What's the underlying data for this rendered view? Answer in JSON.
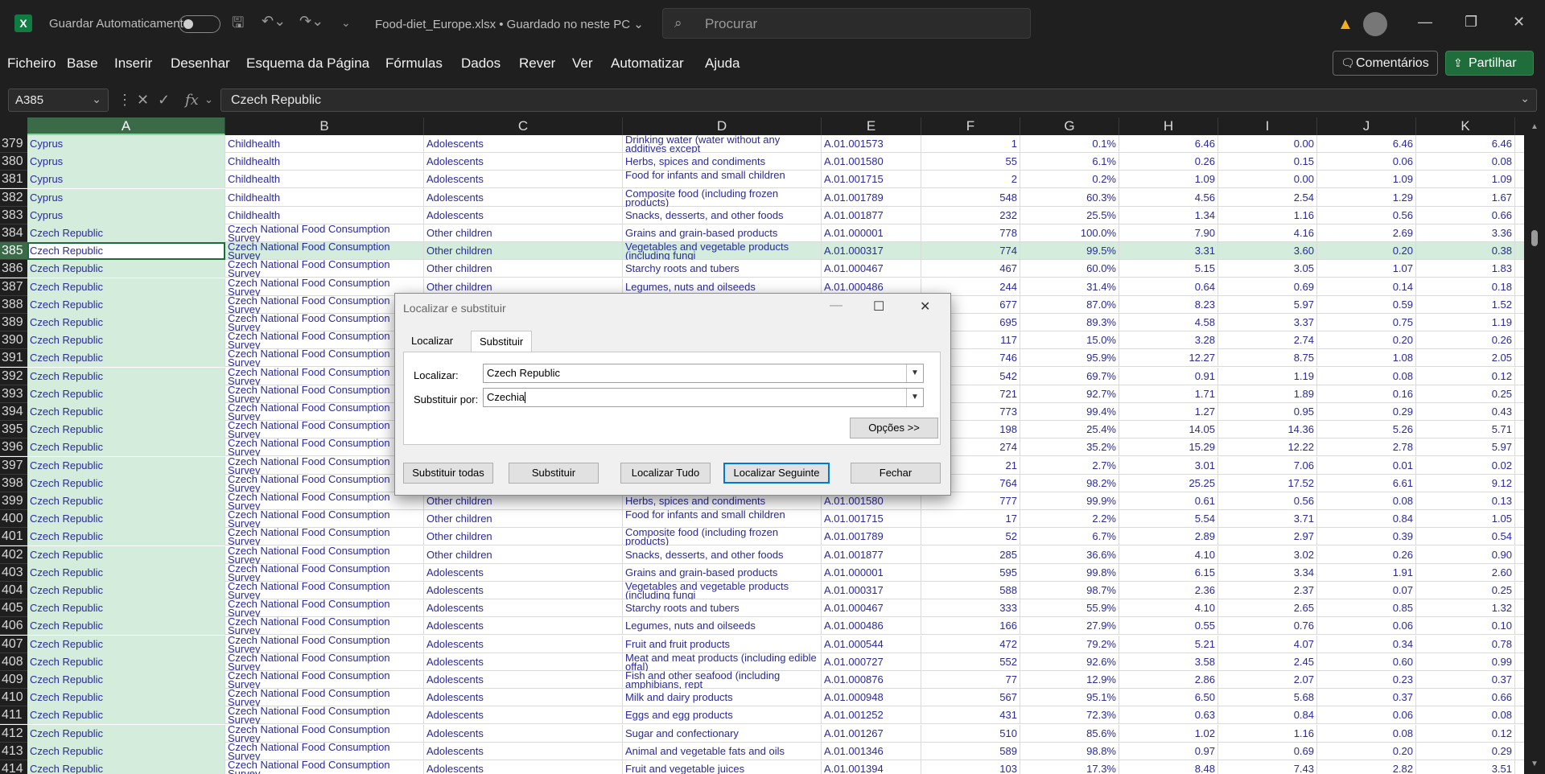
{
  "titlebar": {
    "app_icon": "X",
    "autosave_label": "Guardar Automaticamente",
    "document_title": "Food-diet_Europe.xlsx • Guardado no neste PC ⌄",
    "search_placeholder": "Procurar"
  },
  "menu": [
    "Ficheiro",
    "Base",
    "Inserir",
    "Desenhar",
    "Esquema da Página",
    "Fórmulas",
    "Dados",
    "Rever",
    "Ver",
    "Automatizar",
    "Ajuda"
  ],
  "actions": {
    "comments": "Comentários",
    "share": "Partilhar"
  },
  "formula_bar": {
    "name_box": "A385",
    "formula": "Czech Republic"
  },
  "columns": [
    "A",
    "B",
    "C",
    "D",
    "E",
    "F",
    "G",
    "H",
    "I",
    "J",
    "K"
  ],
  "selected_column": "A",
  "active_row": "385",
  "rows": [
    [
      "379",
      "Cyprus",
      "Childhealth",
      "Adolescents",
      "Drinking water (water without any additives except",
      "A.01.001573",
      "1",
      "0.1%",
      "6.46",
      "0.00",
      "6.46",
      "6.46"
    ],
    [
      "380",
      "Cyprus",
      "Childhealth",
      "Adolescents",
      "Herbs, spices and condiments",
      "A.01.001580",
      "55",
      "6.1%",
      "0.26",
      "0.15",
      "0.06",
      "0.08"
    ],
    [
      "381",
      "Cyprus",
      "Childhealth",
      "Adolescents",
      "Food for infants and small children",
      "A.01.001715",
      "2",
      "0.2%",
      "1.09",
      "0.00",
      "1.09",
      "1.09"
    ],
    [
      "382",
      "Cyprus",
      "Childhealth",
      "Adolescents",
      "Composite food (including frozen products)",
      "A.01.001789",
      "548",
      "60.3%",
      "4.56",
      "2.54",
      "1.29",
      "1.67"
    ],
    [
      "383",
      "Cyprus",
      "Childhealth",
      "Adolescents",
      "Snacks, desserts, and other foods",
      "A.01.001877",
      "232",
      "25.5%",
      "1.34",
      "1.16",
      "0.56",
      "0.66"
    ],
    [
      "384",
      "Czech Republic",
      "Czech National Food Consumption Survey",
      "Other children",
      "Grains and grain-based products",
      "A.01.000001",
      "778",
      "100.0%",
      "7.90",
      "4.16",
      "2.69",
      "3.36"
    ],
    [
      "385",
      "Czech Republic",
      "Czech National Food Consumption Survey",
      "Other children",
      "Vegetables and vegetable products (including fungi",
      "A.01.000317",
      "774",
      "99.5%",
      "3.31",
      "3.60",
      "0.20",
      "0.38"
    ],
    [
      "386",
      "Czech Republic",
      "Czech National Food Consumption Survey",
      "Other children",
      "Starchy roots and tubers",
      "A.01.000467",
      "467",
      "60.0%",
      "5.15",
      "3.05",
      "1.07",
      "1.83"
    ],
    [
      "387",
      "Czech Republic",
      "Czech National Food Consumption Survey",
      "Other children",
      "Legumes, nuts and oilseeds",
      "A.01.000486",
      "244",
      "31.4%",
      "0.64",
      "0.69",
      "0.14",
      "0.18"
    ],
    [
      "388",
      "Czech Republic",
      "Czech National Food Consumption Survey",
      "",
      "",
      "",
      "677",
      "87.0%",
      "8.23",
      "5.97",
      "0.59",
      "1.52"
    ],
    [
      "389",
      "Czech Republic",
      "Czech National Food Consumption Survey",
      "",
      "",
      "",
      "695",
      "89.3%",
      "4.58",
      "3.37",
      "0.75",
      "1.19"
    ],
    [
      "390",
      "Czech Republic",
      "Czech National Food Consumption Survey",
      "",
      "",
      "",
      "117",
      "15.0%",
      "3.28",
      "2.74",
      "0.20",
      "0.26"
    ],
    [
      "391",
      "Czech Republic",
      "Czech National Food Consumption Survey",
      "",
      "",
      "",
      "746",
      "95.9%",
      "12.27",
      "8.75",
      "1.08",
      "2.05"
    ],
    [
      "392",
      "Czech Republic",
      "Czech National Food Consumption Survey",
      "",
      "",
      "",
      "542",
      "69.7%",
      "0.91",
      "1.19",
      "0.08",
      "0.12"
    ],
    [
      "393",
      "Czech Republic",
      "Czech National Food Consumption Survey",
      "",
      "",
      "",
      "721",
      "92.7%",
      "1.71",
      "1.89",
      "0.16",
      "0.25"
    ],
    [
      "394",
      "Czech Republic",
      "Czech National Food Consumption Survey",
      "",
      "",
      "",
      "773",
      "99.4%",
      "1.27",
      "0.95",
      "0.29",
      "0.43"
    ],
    [
      "395",
      "Czech Republic",
      "Czech National Food Consumption Survey",
      "",
      "",
      "",
      "198",
      "25.4%",
      "14.05",
      "14.36",
      "5.26",
      "5.71"
    ],
    [
      "396",
      "Czech Republic",
      "Czech National Food Consumption Survey",
      "",
      "",
      "",
      "274",
      "35.2%",
      "15.29",
      "12.22",
      "2.78",
      "5.97"
    ],
    [
      "397",
      "Czech Republic",
      "Czech National Food Consumption Survey",
      "",
      "",
      "",
      "21",
      "2.7%",
      "3.01",
      "7.06",
      "0.01",
      "0.02"
    ],
    [
      "398",
      "Czech Republic",
      "Czech National Food Consumption Survey",
      "",
      "",
      "",
      "764",
      "98.2%",
      "25.25",
      "17.52",
      "6.61",
      "9.12"
    ],
    [
      "399",
      "Czech Republic",
      "Czech National Food Consumption Survey",
      "Other children",
      "Herbs, spices and condiments",
      "A.01.001580",
      "777",
      "99.9%",
      "0.61",
      "0.56",
      "0.08",
      "0.13"
    ],
    [
      "400",
      "Czech Republic",
      "Czech National Food Consumption Survey",
      "Other children",
      "Food for infants and small children",
      "A.01.001715",
      "17",
      "2.2%",
      "5.54",
      "3.71",
      "0.84",
      "1.05"
    ],
    [
      "401",
      "Czech Republic",
      "Czech National Food Consumption Survey",
      "Other children",
      "Composite food (including frozen products)",
      "A.01.001789",
      "52",
      "6.7%",
      "2.89",
      "2.97",
      "0.39",
      "0.54"
    ],
    [
      "402",
      "Czech Republic",
      "Czech National Food Consumption Survey",
      "Other children",
      "Snacks, desserts, and other foods",
      "A.01.001877",
      "285",
      "36.6%",
      "4.10",
      "3.02",
      "0.26",
      "0.90"
    ],
    [
      "403",
      "Czech Republic",
      "Czech National Food Consumption Survey",
      "Adolescents",
      "Grains and grain-based products",
      "A.01.000001",
      "595",
      "99.8%",
      "6.15",
      "3.34",
      "1.91",
      "2.60"
    ],
    [
      "404",
      "Czech Republic",
      "Czech National Food Consumption Survey",
      "Adolescents",
      "Vegetables and vegetable products (including fungi",
      "A.01.000317",
      "588",
      "98.7%",
      "2.36",
      "2.37",
      "0.07",
      "0.25"
    ],
    [
      "405",
      "Czech Republic",
      "Czech National Food Consumption Survey",
      "Adolescents",
      "Starchy roots and tubers",
      "A.01.000467",
      "333",
      "55.9%",
      "4.10",
      "2.65",
      "0.85",
      "1.32"
    ],
    [
      "406",
      "Czech Republic",
      "Czech National Food Consumption Survey",
      "Adolescents",
      "Legumes, nuts and oilseeds",
      "A.01.000486",
      "166",
      "27.9%",
      "0.55",
      "0.76",
      "0.06",
      "0.10"
    ],
    [
      "407",
      "Czech Republic",
      "Czech National Food Consumption Survey",
      "Adolescents",
      "Fruit and fruit products",
      "A.01.000544",
      "472",
      "79.2%",
      "5.21",
      "4.07",
      "0.34",
      "0.78"
    ],
    [
      "408",
      "Czech Republic",
      "Czech National Food Consumption Survey",
      "Adolescents",
      "Meat and meat products (including edible offal)",
      "A.01.000727",
      "552",
      "92.6%",
      "3.58",
      "2.45",
      "0.60",
      "0.99"
    ],
    [
      "409",
      "Czech Republic",
      "Czech National Food Consumption Survey",
      "Adolescents",
      "Fish and other seafood (including amphibians, rept",
      "A.01.000876",
      "77",
      "12.9%",
      "2.86",
      "2.07",
      "0.23",
      "0.37"
    ],
    [
      "410",
      "Czech Republic",
      "Czech National Food Consumption Survey",
      "Adolescents",
      "Milk and dairy products",
      "A.01.000948",
      "567",
      "95.1%",
      "6.50",
      "5.68",
      "0.37",
      "0.66"
    ],
    [
      "411",
      "Czech Republic",
      "Czech National Food Consumption Survey",
      "Adolescents",
      "Eggs and egg products",
      "A.01.001252",
      "431",
      "72.3%",
      "0.63",
      "0.84",
      "0.06",
      "0.08"
    ],
    [
      "412",
      "Czech Republic",
      "Czech National Food Consumption Survey",
      "Adolescents",
      "Sugar and confectionary",
      "A.01.001267",
      "510",
      "85.6%",
      "1.02",
      "1.16",
      "0.08",
      "0.12"
    ],
    [
      "413",
      "Czech Republic",
      "Czech National Food Consumption Survey",
      "Adolescents",
      "Animal and vegetable fats and oils",
      "A.01.001346",
      "589",
      "98.8%",
      "0.97",
      "0.69",
      "0.20",
      "0.29"
    ],
    [
      "414",
      "Czech Republic",
      "Czech National Food Consumption Survey",
      "Adolescents",
      "Fruit and vegetable juices",
      "A.01.001394",
      "103",
      "17.3%",
      "8.48",
      "7.43",
      "2.82",
      "3.51"
    ]
  ],
  "dialog": {
    "title": "Localizar e substituir",
    "tabs": [
      "Localizar",
      "Substituir"
    ],
    "selected_tab": "Substituir",
    "find_label": "Localizar:",
    "find_value": "Czech Republic",
    "replace_label": "Substituir por:",
    "replace_value": "Czechia",
    "options_button": "Opções >>",
    "buttons": {
      "replace_all": "Substituir todas",
      "replace": "Substituir",
      "find_all": "Localizar Tudo",
      "find_next": "Localizar Seguinte",
      "close": "Fechar"
    }
  }
}
